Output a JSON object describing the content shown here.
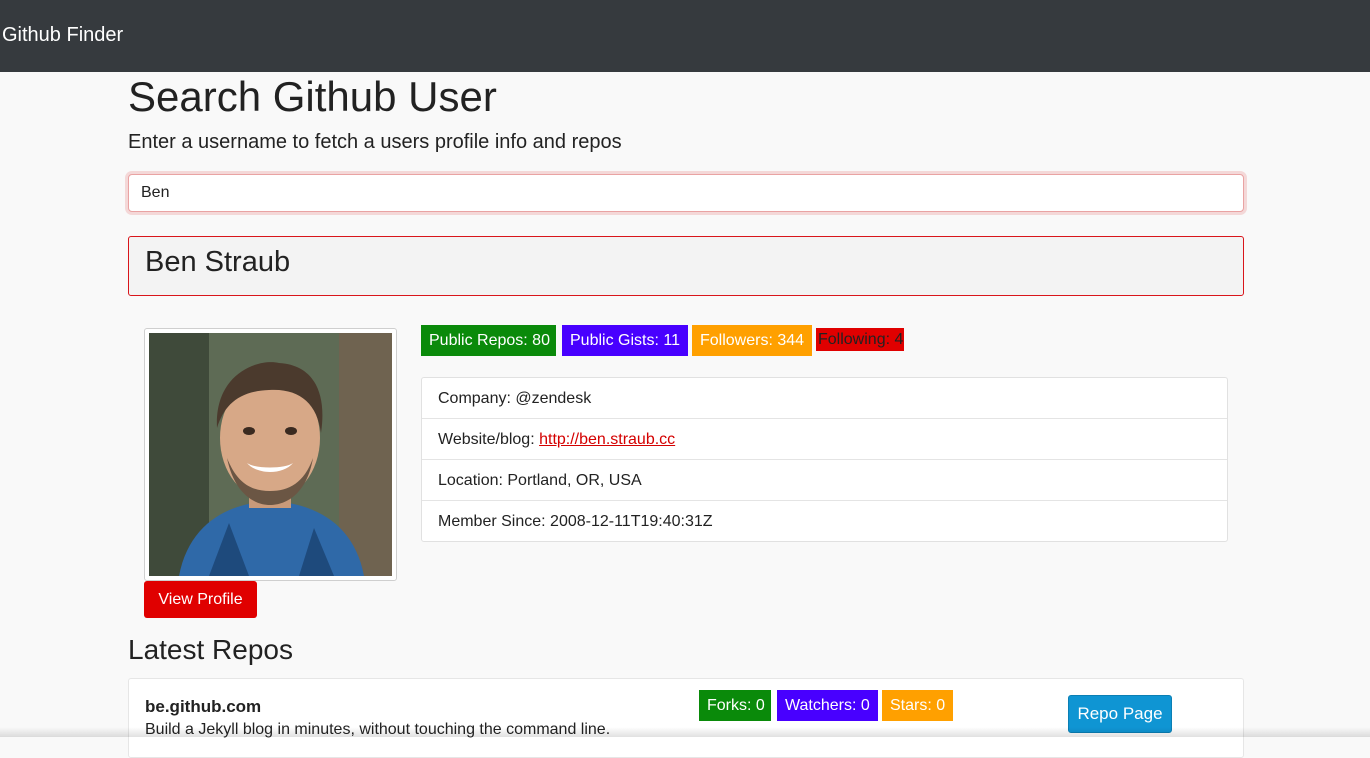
{
  "navbar": {
    "brand": "Github Finder"
  },
  "header": {
    "title": "Search Github User",
    "subtitle": "Enter a username to fetch a users profile info and repos"
  },
  "search": {
    "value": "Ben",
    "placeholder": ""
  },
  "profile": {
    "name": "Ben Straub",
    "avatar_icon": "user-avatar-photo",
    "view_profile_label": "View Profile",
    "badges": {
      "public_repos": "Public Repos: 80",
      "public_gists": "Public Gists: 11",
      "followers": "Followers: 344",
      "following": "Following: 4"
    },
    "badge_colors": {
      "public_repos": "#0a8a0a",
      "public_gists": "#4800ff",
      "followers": "#ffa000",
      "following": "#e00000"
    },
    "details": {
      "company": "Company: @zendesk",
      "website_label": "Website/blog: ",
      "website_link": "http://ben.straub.cc",
      "location": "Location: Portland, OR, USA",
      "member_since": "Member Since: 2008-12-11T19:40:31Z"
    }
  },
  "repos": {
    "heading": "Latest Repos",
    "items": [
      {
        "name": "be.github.com",
        "description": "Build a Jekyll blog in minutes, without touching the command line.",
        "forks": "Forks: 0",
        "watchers": "Watchers: 0",
        "stars": "Stars: 0",
        "button_label": "Repo Page"
      }
    ]
  },
  "colors": {
    "navbar": "#363a3e",
    "accent_red": "#e00000",
    "repo_button": "#0f95d3"
  }
}
